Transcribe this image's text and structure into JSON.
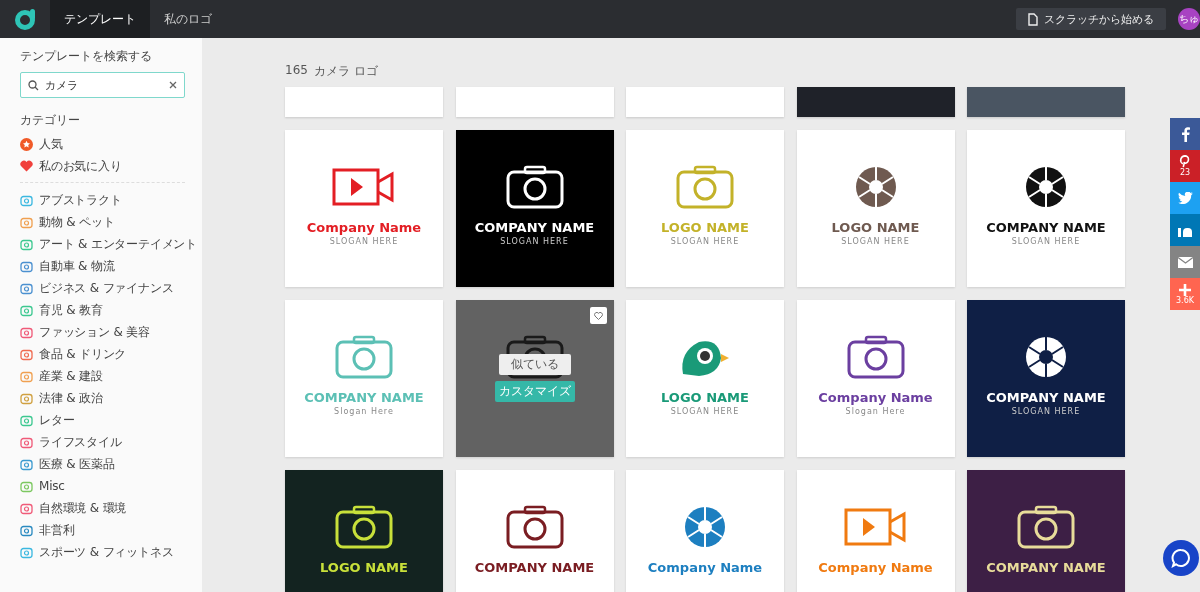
{
  "header": {
    "tabs": [
      {
        "label": "テンプレート",
        "selected": true
      },
      {
        "label": "私のロゴ",
        "selected": false
      }
    ],
    "start_button": "スクラッチから始める",
    "avatar": "ちゅ"
  },
  "sidebar": {
    "search_heading": "テンプレートを検索する",
    "search": {
      "value": "カメラ"
    },
    "categories_heading": "カテゴリー",
    "top_items": [
      {
        "kind": "star",
        "label": "人気",
        "color": "#f05a28"
      },
      {
        "kind": "heart",
        "label": "私のお気に入り",
        "color": "#f0403c"
      }
    ],
    "categories": [
      {
        "label": "アブストラクト",
        "color": "#3bb8e0"
      },
      {
        "label": "動物 & ペット",
        "color": "#f0a050"
      },
      {
        "label": "アート & エンターテイメント",
        "color": "#3cc890"
      },
      {
        "label": "自動車 & 物流",
        "color": "#4a90d0"
      },
      {
        "label": "ビジネス & ファイナンス",
        "color": "#4a90d0"
      },
      {
        "label": "育児 & 教育",
        "color": "#3cc890"
      },
      {
        "label": "ファッション & 美容",
        "color": "#f05a78"
      },
      {
        "label": "食品 & ドリンク",
        "color": "#f06a50"
      },
      {
        "label": "産業 & 建設",
        "color": "#f0a050"
      },
      {
        "label": "法律 & 政治",
        "color": "#d0a040"
      },
      {
        "label": "レター",
        "color": "#3cc890"
      },
      {
        "label": "ライフスタイル",
        "color": "#f05a78"
      },
      {
        "label": "医療 & 医薬品",
        "color": "#3b9ad0"
      },
      {
        "label": "Misc",
        "color": "#7cc860"
      },
      {
        "label": "自然環境 & 環境",
        "color": "#f05a78"
      },
      {
        "label": "非営利",
        "color": "#2a8ac0"
      },
      {
        "label": "スポーツ & フィットネス",
        "color": "#3bb8e0"
      }
    ]
  },
  "results": {
    "count": "165",
    "query": "カメラ ロゴ",
    "cards": [
      {
        "kind": "video",
        "color": "#e31e24",
        "name": "Company Name",
        "slogan": "SLOGAN HERE",
        "hovered": false
      },
      {
        "kind": "camera",
        "color": "#ffffff",
        "name": "COMPANY NAME",
        "slogan": "SLOGAN HERE",
        "hovered": false
      },
      {
        "kind": "camera",
        "color": "#c3b229",
        "name": "LOGO NAME",
        "slogan": "SLOGAN HERE",
        "hovered": false
      },
      {
        "kind": "shutter",
        "color": "#6f5a50",
        "name": "LOGO NAME",
        "slogan": "SLOGAN HERE",
        "hovered": false
      },
      {
        "kind": "shutter",
        "color": "#111111",
        "name": "COMPANY NAME",
        "slogan": "SLOGAN HERE",
        "hovered": false
      },
      {
        "kind": "camera",
        "color": "#5cc0b5",
        "name": "COMPANY NAME",
        "slogan": "Slogan Here",
        "hovered": false
      },
      {
        "kind": "camera",
        "hovered": true,
        "similar_button": "似ている",
        "customize_button": "カスタマイズ"
      },
      {
        "kind": "bird",
        "color": "#1a9a78",
        "name": "LOGO NAME",
        "slogan": "SLOGAN HERE",
        "hovered": false
      },
      {
        "kind": "camera",
        "color": "#6b3fa0",
        "name": "Company Name",
        "slogan": "Slogan Here",
        "hovered": false
      },
      {
        "kind": "shutter",
        "color": "#ffffff",
        "name": "COMPANY NAME",
        "slogan": "SLOGAN HERE",
        "hovered": false
      },
      {
        "kind": "camera",
        "color": "#c8e03a",
        "name": "LOGO NAME",
        "hovered": false
      },
      {
        "kind": "camera",
        "color": "#7a1d22",
        "name": "COMPANY NAME",
        "hovered": false
      },
      {
        "kind": "shutter",
        "color": "#1d7fc0",
        "name": "Company Name",
        "hovered": false
      },
      {
        "kind": "video",
        "color": "#f07a10",
        "name": "Company Name",
        "hovered": false
      },
      {
        "kind": "camera",
        "color": "#e8dc9a",
        "name": "COMPANY NAME",
        "hovered": false
      }
    ]
  },
  "share_bar": [
    {
      "kind": "facebook"
    },
    {
      "kind": "pinterest",
      "count": "23"
    },
    {
      "kind": "twitter"
    },
    {
      "kind": "linkedin"
    },
    {
      "kind": "email"
    },
    {
      "kind": "more",
      "count": "3.6K"
    }
  ]
}
